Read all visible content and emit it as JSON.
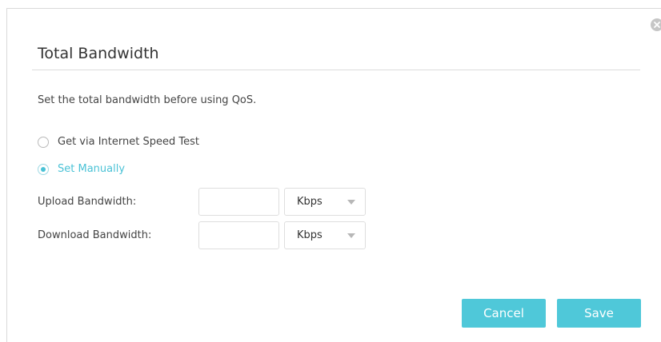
{
  "dialog": {
    "title": "Total Bandwidth",
    "description": "Set the total bandwidth before using QoS."
  },
  "options": [
    {
      "label": "Get via Internet Speed Test",
      "selected": false
    },
    {
      "label": "Set Manually",
      "selected": true
    }
  ],
  "fields": {
    "upload": {
      "label": "Upload Bandwidth:",
      "value": "",
      "unit": "Kbps"
    },
    "download": {
      "label": "Download Bandwidth:",
      "value": "",
      "unit": "Kbps"
    }
  },
  "buttons": {
    "cancel": "Cancel",
    "save": "Save"
  },
  "colors": {
    "accent": "#4fc8d9",
    "selected_text": "#4ac2d6"
  },
  "icons": {
    "close": "close-icon",
    "caret": "chevron-down-icon"
  }
}
